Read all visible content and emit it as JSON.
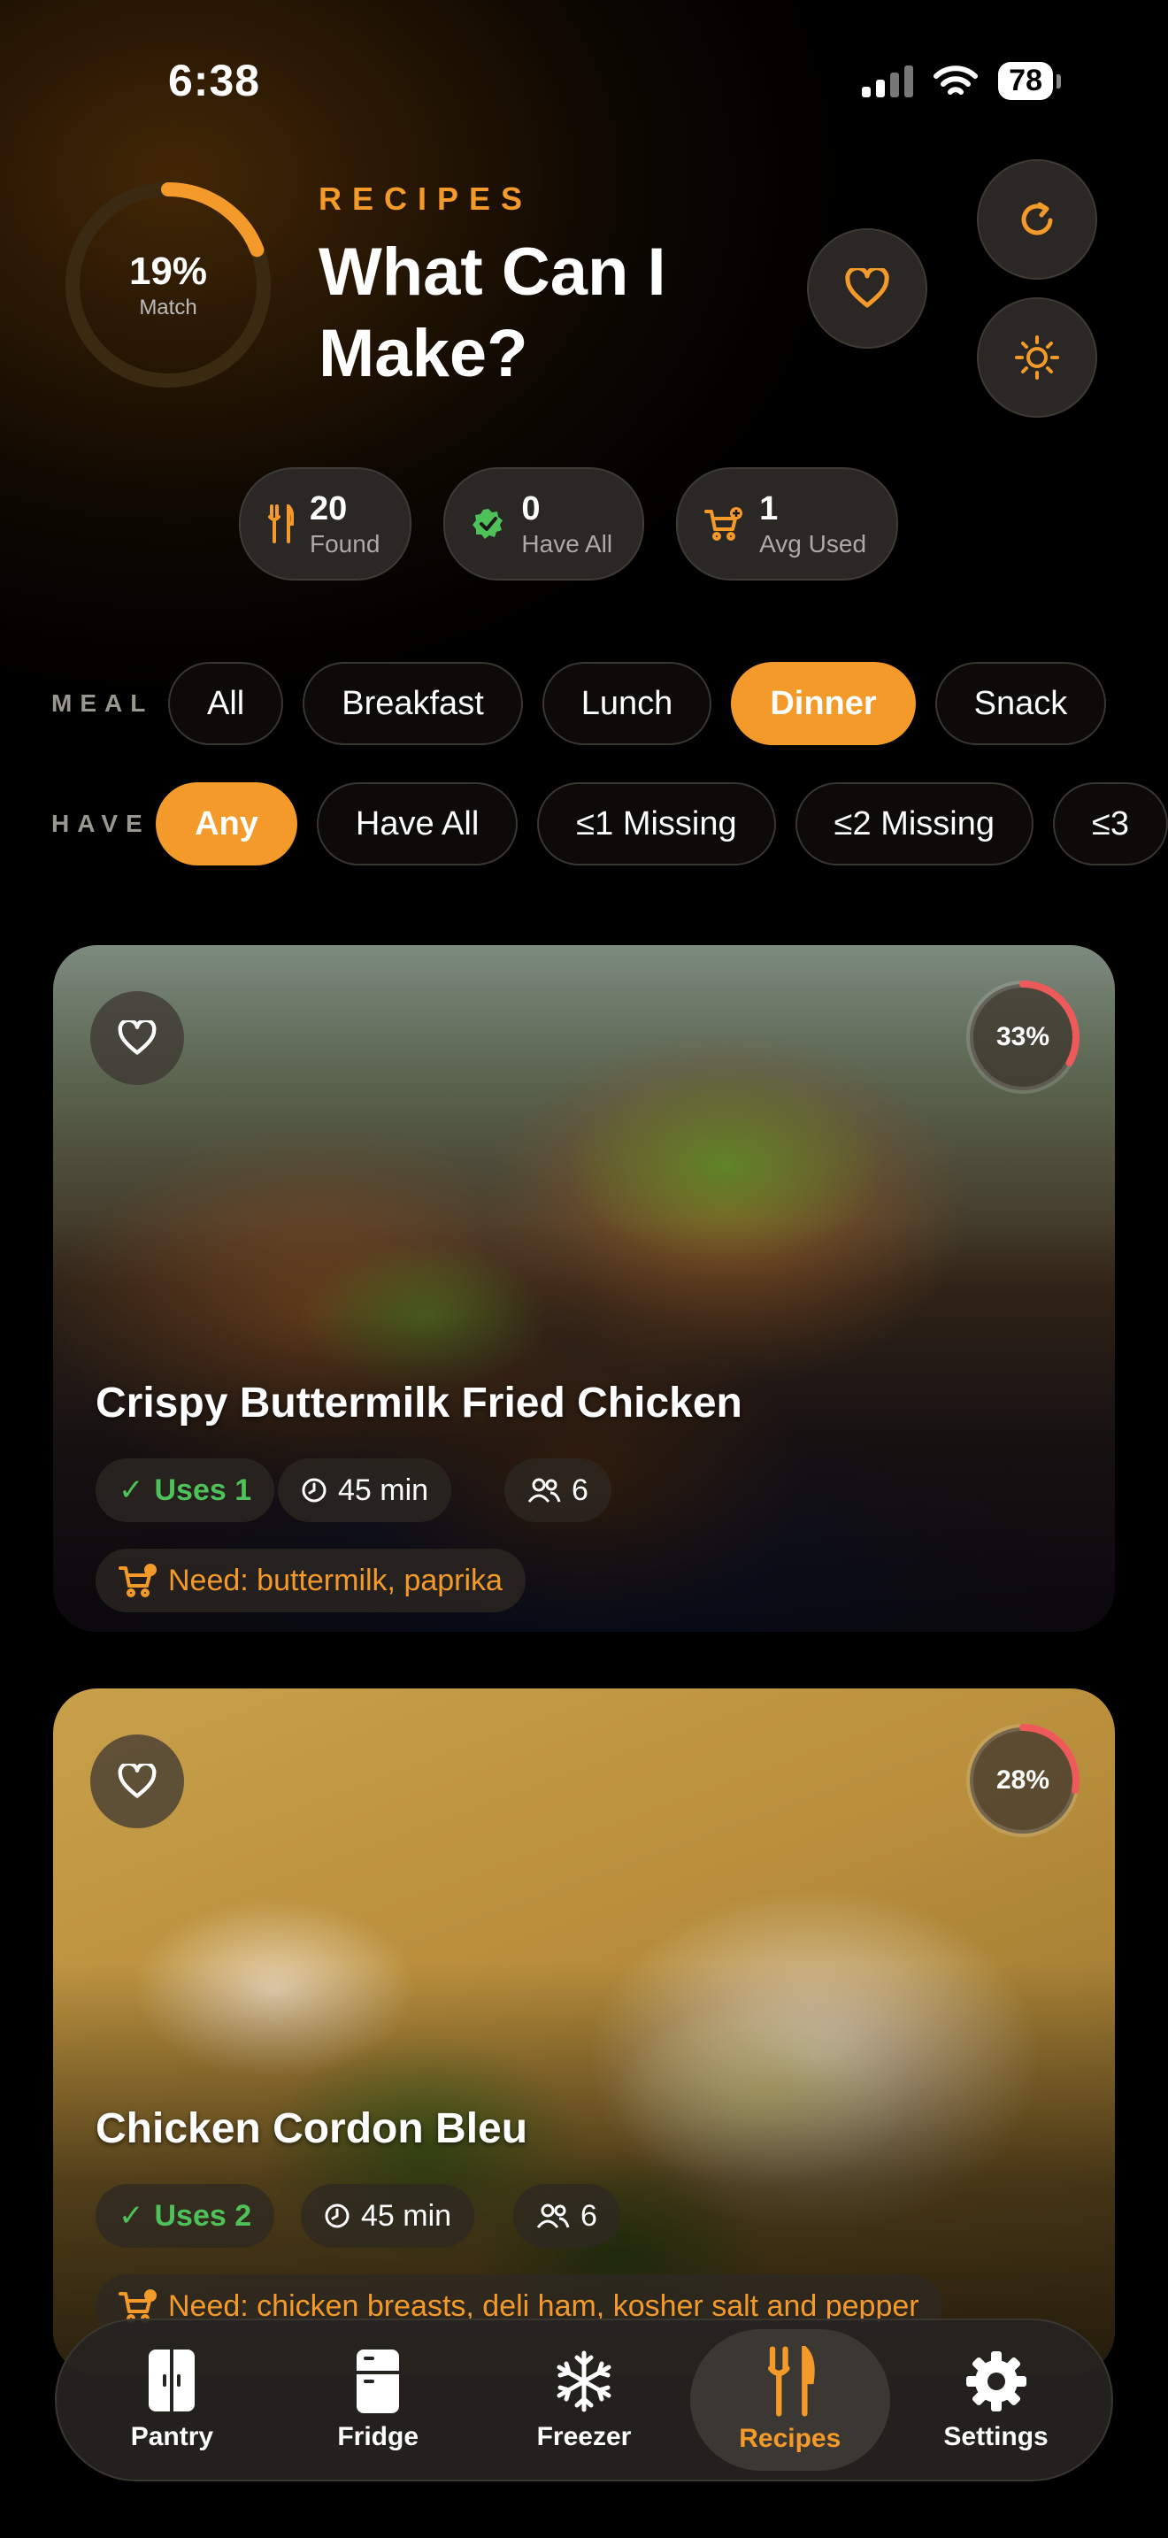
{
  "status": {
    "time": "6:38",
    "battery": "78"
  },
  "header": {
    "match_percent": "19%",
    "match_fraction": 0.19,
    "match_label": "Match",
    "eyebrow": "RECIPES",
    "title": "What Can I Make?"
  },
  "stats": [
    {
      "value": "20",
      "label": "Found",
      "icon": "fork-knife-icon"
    },
    {
      "value": "0",
      "label": "Have All",
      "icon": "verified-check-icon"
    },
    {
      "value": "1",
      "label": "Avg Used",
      "icon": "cart-plus-icon"
    }
  ],
  "filters": {
    "meal": {
      "label": "MEAL",
      "options": [
        "All",
        "Breakfast",
        "Lunch",
        "Dinner",
        "Snack"
      ],
      "selected": "Dinner"
    },
    "have": {
      "label": "HAVE",
      "options": [
        "Any",
        "Have All",
        "≤1 Missing",
        "≤2 Missing",
        "≤3"
      ],
      "selected": "Any"
    }
  },
  "recipes": [
    {
      "title": "Crispy Buttermilk Fried Chicken",
      "match": "33%",
      "match_fraction": 0.33,
      "uses": "Uses 1",
      "time": "45 min",
      "servings": "6",
      "need": "Need: buttermilk, paprika"
    },
    {
      "title": "Chicken Cordon Bleu",
      "match": "28%",
      "match_fraction": 0.28,
      "uses": "Uses 2",
      "time": "45 min",
      "servings": "6",
      "need": "Need: chicken breasts, deli ham, kosher salt and pepper"
    }
  ],
  "tabs": [
    {
      "label": "Pantry",
      "icon": "pantry-cabinet-icon"
    },
    {
      "label": "Fridge",
      "icon": "fridge-icon"
    },
    {
      "label": "Freezer",
      "icon": "snowflake-icon"
    },
    {
      "label": "Recipes",
      "icon": "fork-knife-icon"
    },
    {
      "label": "Settings",
      "icon": "gear-icon"
    }
  ],
  "active_tab": "Recipes",
  "colors": {
    "accent": "#f39a2b",
    "success": "#4fc159",
    "match_ring": "#ee5a5a"
  }
}
